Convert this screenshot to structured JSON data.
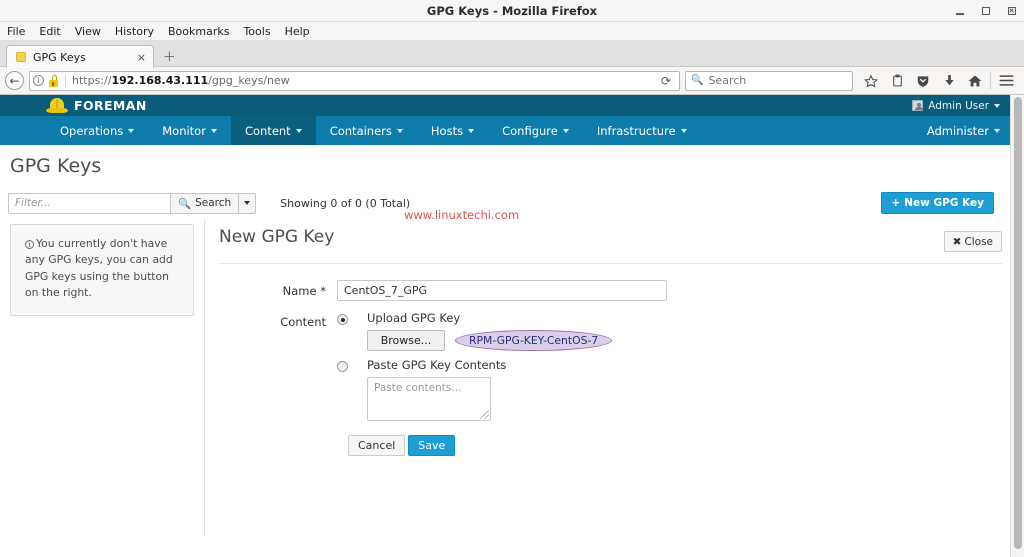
{
  "window": {
    "title": "GPG Keys - Mozilla Firefox",
    "controls": {
      "minimize": "minimize-icon",
      "maximize": "maximize-icon",
      "close": "close-icon"
    }
  },
  "menubar": [
    "File",
    "Edit",
    "View",
    "History",
    "Bookmarks",
    "Tools",
    "Help"
  ],
  "tab": {
    "title": "GPG Keys",
    "close": "×",
    "new_tab": "+",
    "favicon": "page-favicon"
  },
  "navbar": {
    "back": "←",
    "identity_icon": "i",
    "lock_icon": "insecure-lock-icon",
    "url_protocol": "https://",
    "url_host": "192.168.43.111",
    "url_path": "/gpg_keys/new",
    "reload": "⟳",
    "search_placeholder": "Search",
    "search_icon": "search-icon",
    "icons": [
      "bookmark-star-icon",
      "reader-list-icon",
      "pocket-shield-icon",
      "downloads-icon",
      "home-icon",
      "hamburger-menu-icon"
    ]
  },
  "foreman": {
    "brand": "FOREMAN",
    "logo": "hardhat-icon",
    "user": {
      "name": "Admin User",
      "avatar": "user-avatar-icon"
    },
    "nav": [
      {
        "label": "Operations",
        "active": false
      },
      {
        "label": "Monitor",
        "active": false
      },
      {
        "label": "Content",
        "active": true
      },
      {
        "label": "Containers",
        "active": false
      },
      {
        "label": "Hosts",
        "active": false
      },
      {
        "label": "Configure",
        "active": false
      },
      {
        "label": "Infrastructure",
        "active": false
      }
    ],
    "administer": "Administer"
  },
  "page": {
    "title": "GPG Keys",
    "filter_placeholder": "Filter...",
    "search_label": "Search",
    "showing": "Showing 0 of 0 (0 Total)",
    "watermark": "www.linuxtechi.com",
    "new_button": "New GPG Key",
    "new_button_plus": "+"
  },
  "left_panel": {
    "info_icon": "info-icon",
    "message": "You currently don't have any GPG keys, you can add GPG keys using the button on the right."
  },
  "form": {
    "title": "New GPG Key",
    "close_label": "Close",
    "close_icon": "✖",
    "name_label": "Name *",
    "name_value": "CentOS_7_GPG",
    "content_label": "Content",
    "upload_option": "Upload GPG Key",
    "upload_selected": true,
    "browse_label": "Browse...",
    "filename": "RPM-GPG-KEY-CentOS-7",
    "paste_option": "Paste GPG Key Contents",
    "paste_placeholder": "Paste contents...",
    "cancel_label": "Cancel",
    "save_label": "Save"
  },
  "colors": {
    "foreman_top": "#0b5c7a",
    "foreman_nav": "#0d7cab",
    "foreman_nav_active": "#0a5e80",
    "primary_button": "#1f9ed4",
    "watermark": "#d9554f",
    "highlight_fill": "#d9cfe8",
    "highlight_stroke": "#9b6fa8"
  }
}
